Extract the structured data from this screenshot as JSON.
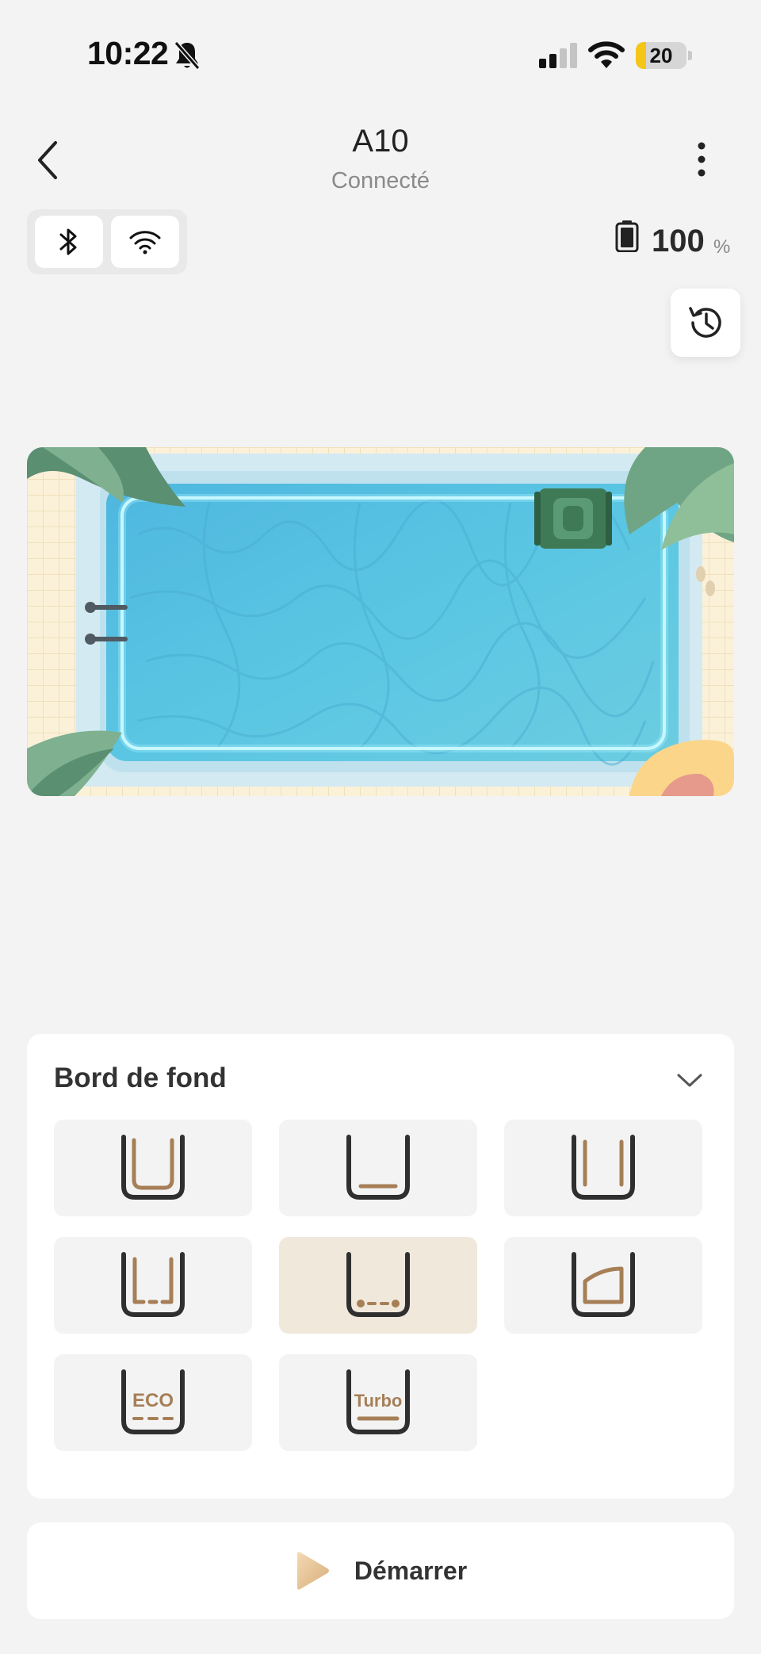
{
  "status_bar": {
    "time": "10:22",
    "battery_level": "20",
    "battery_fraction": 0.2,
    "icons": [
      "bell-off-icon",
      "cellular-signal-icon",
      "wifi-icon",
      "battery-icon"
    ]
  },
  "header": {
    "title": "A10",
    "subtitle": "Connecté",
    "icons": [
      "chevron-left-icon",
      "more-vertical-icon"
    ]
  },
  "connection": {
    "icons": [
      "bluetooth-icon",
      "wifi-icon"
    ]
  },
  "device_battery": {
    "value": "100",
    "unit": "%",
    "icon": "battery-full-icon"
  },
  "history": {
    "icon": "history-icon"
  },
  "pool_map": {
    "icon": "robot-cleaner-icon"
  },
  "cleaning_mode": {
    "title": "Bord de fond",
    "selected_index": 4,
    "modes": [
      {
        "icon": "mode-floor-walls-icon"
      },
      {
        "icon": "mode-floor-icon"
      },
      {
        "icon": "mode-walls-icon"
      },
      {
        "icon": "mode-floor-edge-walls-icon"
      },
      {
        "icon": "mode-floor-edge-icon"
      },
      {
        "icon": "mode-waterline-icon"
      },
      {
        "icon": "mode-eco-icon",
        "label": "ECO"
      },
      {
        "icon": "mode-turbo-icon",
        "label": "Turbo"
      }
    ]
  },
  "start_button": {
    "label": "Démarrer",
    "icon": "play-icon"
  },
  "colors": {
    "background": "#f3f3f3",
    "accent_brown": "#a67f57",
    "selected_mode_bg": "#f1e8dc",
    "pool_water": "#5cc3e0",
    "status_battery": "#f5c518"
  }
}
